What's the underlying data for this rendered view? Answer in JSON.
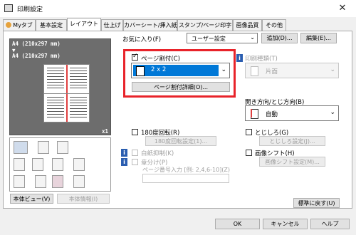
{
  "window": {
    "title": "印刷設定",
    "close_glyph": "✕"
  },
  "tabs": [
    "Myタブ",
    "基本設定",
    "レイアウト",
    "仕上げ",
    "カバーシート/挿入紙",
    "スタンプ/ページ印字",
    "画像品質",
    "その他"
  ],
  "preview": {
    "paper_line1": "A4 (210x297 mm)",
    "arrow": "▼",
    "paper_line2": "A4 (210x297 mm)",
    "copies": "x1"
  },
  "favorites": {
    "label": "お気に入り(F)",
    "value": "ユーザー設定",
    "add": "追加(D)...",
    "edit": "編集(E)..."
  },
  "page_layout": {
    "checkbox_label": "ページ割付(C)",
    "checked": true,
    "selection": "2 x 2",
    "detail_button": "ページ割付詳細(O)...",
    "highlight_color": "#e8232a",
    "select_color": "#0078d7"
  },
  "print_type": {
    "label": "印刷種類(T)",
    "value": "片面"
  },
  "binding": {
    "label": "開き方向/とじ方向(B)",
    "value": "自動"
  },
  "rotate": {
    "label": "180度回転(R)",
    "button": "180度回転設定(1)..."
  },
  "staple": {
    "label": "とじしろ(G)",
    "button": "とじしろ設定(J)..."
  },
  "blank_suppress": {
    "label": "白紙抑制(K)"
  },
  "image_shift": {
    "label": "画像シフト(H)",
    "button": "画像シフト設定(M)..."
  },
  "chapter": {
    "label": "章分け(P)",
    "sub_label": "ページ番号入力 [例: 2,4,6-10](Z)"
  },
  "left_buttons": {
    "device_view": "本体ビュー(V)",
    "device_info": "本体情報(I)"
  },
  "defaults_button": "標準に戻す(U)",
  "footer": {
    "ok": "OK",
    "cancel": "キャンセル",
    "help": "ヘルプ"
  },
  "info_glyph": "i"
}
